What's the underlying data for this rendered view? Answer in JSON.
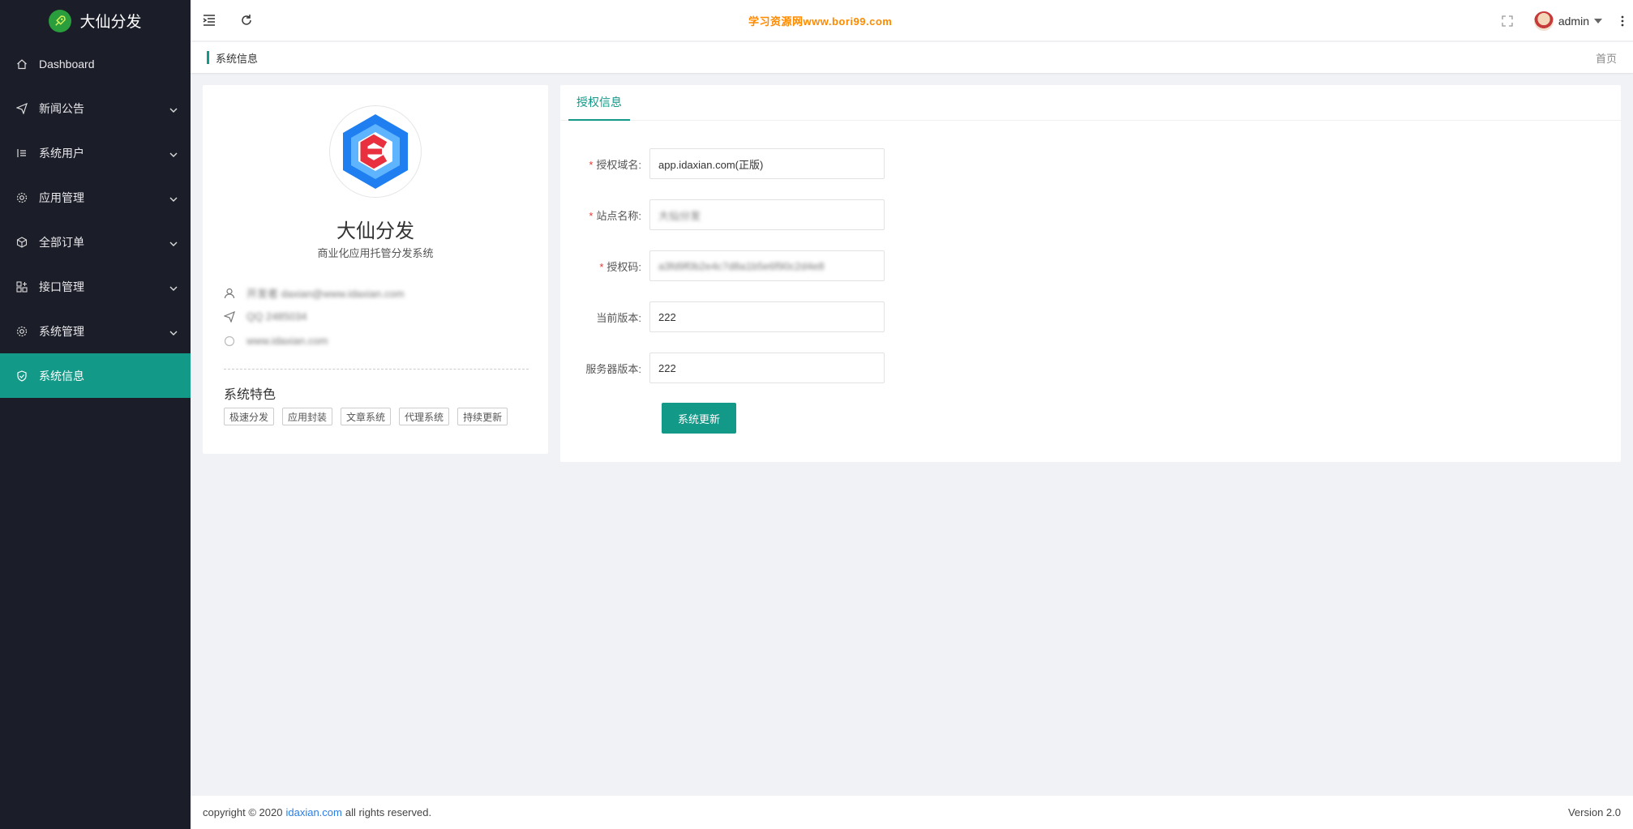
{
  "app": {
    "name": "大仙分发"
  },
  "sidebar": {
    "items": [
      {
        "label": "Dashboard",
        "icon": "home-icon",
        "expandable": false,
        "active": false
      },
      {
        "label": "新闻公告",
        "icon": "send-icon",
        "expandable": true,
        "active": false
      },
      {
        "label": "系统用户",
        "icon": "users-icon",
        "expandable": true,
        "active": false
      },
      {
        "label": "应用管理",
        "icon": "gear-icon",
        "expandable": true,
        "active": false
      },
      {
        "label": "全部订单",
        "icon": "box-icon",
        "expandable": true,
        "active": false
      },
      {
        "label": "接口管理",
        "icon": "api-icon",
        "expandable": true,
        "active": false
      },
      {
        "label": "系统管理",
        "icon": "settings-icon",
        "expandable": true,
        "active": false
      },
      {
        "label": "系统信息",
        "icon": "shield-check-icon",
        "expandable": false,
        "active": true
      }
    ]
  },
  "header": {
    "banner": "学习资源网www.bori99.com",
    "user": "admin"
  },
  "breadcrumb": {
    "title": "系统信息",
    "home": "首页"
  },
  "profile": {
    "name": "大仙分发",
    "subtitle": "商业化应用托管分发系统",
    "owner": "开发者 daxian@www.idaxian.com",
    "qq": "QQ 2485034",
    "site": "www.idaxian.com",
    "features_title": "系统特色",
    "features": [
      "极速分发",
      "应用封装",
      "文章系统",
      "代理系统",
      "持续更新"
    ]
  },
  "license": {
    "tab": "授权信息",
    "fields": [
      {
        "label": "授权域名:",
        "required": true,
        "value": "app.idaxian.com(正版)",
        "blurred": false
      },
      {
        "label": "站点名称:",
        "required": true,
        "value": "大仙分发",
        "blurred": true
      },
      {
        "label": "授权码:",
        "required": true,
        "value": "a3fd9f0b2e4c7d8a1b5e6f90c2d4e8",
        "blurred": true
      },
      {
        "label": "当前版本:",
        "required": false,
        "value": "222",
        "blurred": false
      },
      {
        "label": "服务器版本:",
        "required": false,
        "value": "222",
        "blurred": false
      }
    ],
    "submit": "系统更新"
  },
  "footer": {
    "prefix": "copyright © 2020",
    "link": "idaxian.com",
    "suffix": "all rights reserved.",
    "version": "Version 2.0"
  },
  "colors": {
    "sidebar_bg": "#1b1d28",
    "accent": "#129988",
    "banner": "#ff8a00",
    "required": "#e53935"
  }
}
